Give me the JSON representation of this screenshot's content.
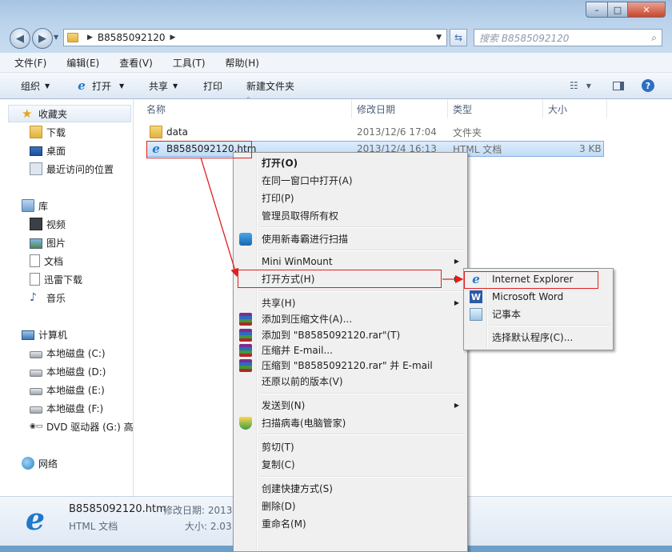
{
  "window": {
    "controls": {
      "minimize": "–",
      "maximize": "□",
      "close": "✕"
    }
  },
  "address": {
    "path": "B8585092120",
    "search_placeholder": "搜索 B8585092120"
  },
  "menubar": [
    "文件(F)",
    "编辑(E)",
    "查看(V)",
    "工具(T)",
    "帮助(H)"
  ],
  "toolbar": {
    "organize": "组织",
    "open": "打开",
    "share": "共享",
    "print": "打印",
    "new_folder": "新建文件夹"
  },
  "navpane": {
    "favorites": "收藏夹",
    "downloads": "下载",
    "desktop": "桌面",
    "recent": "最近访问的位置",
    "libraries": "库",
    "videos": "视频",
    "pictures": "图片",
    "documents": "文档",
    "xunlei": "迅雷下载",
    "music": "音乐",
    "computer": "计算机",
    "drive_c": "本地磁盘 (C:)",
    "drive_d": "本地磁盘 (D:)",
    "drive_e": "本地磁盘 (E:)",
    "drive_f": "本地磁盘 (F:)",
    "dvd": "DVD 驱动器 (G:) 高",
    "network": "网络"
  },
  "columns": {
    "name": "名称",
    "date": "修改日期",
    "type": "类型",
    "size": "大小"
  },
  "files": [
    {
      "name": "data",
      "date": "2013/12/6 17:04",
      "type": "文件夹",
      "size": ""
    },
    {
      "name": "B8585092120.htm",
      "date": "2013/12/4 16:13",
      "type": "HTML 文档",
      "size": "3 KB"
    }
  ],
  "details": {
    "filename": "B8585092120.htm",
    "type": "HTML 文档",
    "modified_label": "修改日期: 2013",
    "size_label": "大小: 2.03"
  },
  "context_menu": {
    "open": "打开(O)",
    "open_same_window": "在同一窗口中打开(A)",
    "print": "打印(P)",
    "take_ownership": "管理员取得所有权",
    "scan_virus": "使用新毒霸进行扫描",
    "mini_winmount": "Mini WinMount",
    "open_with": "打开方式(H)",
    "share": "共享(H)",
    "add_archive": "添加到压缩文件(A)...",
    "add_rar": "添加到 \"B8585092120.rar\"(T)",
    "compress_email": "压缩并 E-mail...",
    "compress_rar_email": "压缩到 \"B8585092120.rar\" 并 E-mail",
    "restore": "还原以前的版本(V)",
    "send_to": "发送到(N)",
    "scan_pc_manager": "扫描病毒(电脑管家)",
    "cut": "剪切(T)",
    "copy": "复制(C)",
    "create_shortcut": "创建快捷方式(S)",
    "delete": "删除(D)",
    "rename": "重命名(M)"
  },
  "submenu": {
    "ie": "Internet Explorer",
    "word": "Microsoft Word",
    "notepad": "记事本",
    "choose_default": "选择默认程序(C)..."
  },
  "colors": {
    "annotation": "#e02020",
    "selection": "#cde4f7"
  }
}
